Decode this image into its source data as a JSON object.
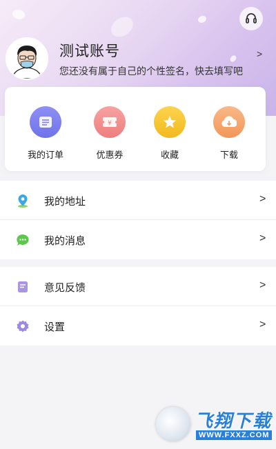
{
  "profile": {
    "username": "测试账号",
    "signature": "您还没有属于自己的个性签名，快去填写吧",
    "chevron": ">"
  },
  "quick_actions": [
    {
      "label": "我的订单",
      "icon": "order-list-icon",
      "color": "#7b7ff0"
    },
    {
      "label": "优惠券",
      "icon": "coupon-icon",
      "color": "#f28a8a"
    },
    {
      "label": "收藏",
      "icon": "star-icon",
      "color": "#f7c436"
    },
    {
      "label": "下载",
      "icon": "download-icon",
      "color": "#f6a76a"
    }
  ],
  "menu_group_1": [
    {
      "label": "我的地址",
      "icon": "location-pin-icon",
      "chevron": ">"
    },
    {
      "label": "我的消息",
      "icon": "chat-bubble-icon",
      "chevron": ">"
    }
  ],
  "menu_group_2": [
    {
      "label": "意见反馈",
      "icon": "feedback-icon",
      "chevron": ">"
    },
    {
      "label": "设置",
      "icon": "settings-gear-icon",
      "chevron": ">"
    }
  ],
  "watermark": {
    "brand": "飞翔下载",
    "url": "WWW.FXXZ.COM"
  }
}
